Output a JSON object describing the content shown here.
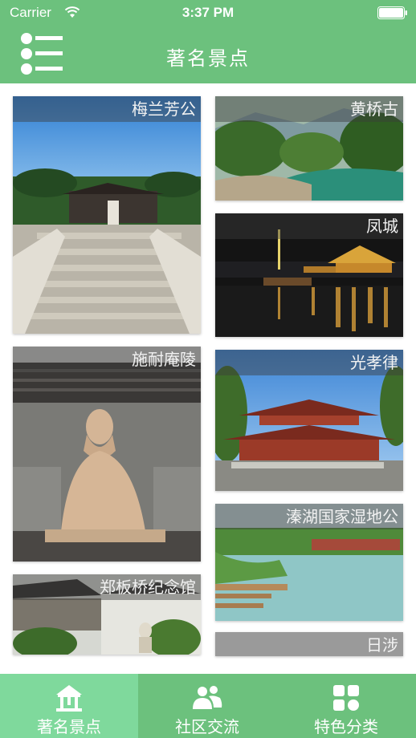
{
  "status_bar": {
    "carrier": "Carrier",
    "time": "3:37 PM"
  },
  "nav": {
    "title": "著名景点",
    "menu_icon": "list-menu-icon"
  },
  "spots": [
    {
      "name": "梅兰芳公"
    },
    {
      "name": "黄桥古"
    },
    {
      "name": "凤城"
    },
    {
      "name": "施耐庵陵"
    },
    {
      "name": "光孝律"
    },
    {
      "name": "溱湖国家湿地公"
    },
    {
      "name": "郑板桥纪念馆"
    },
    {
      "name": "日涉"
    }
  ],
  "tabs": [
    {
      "label": "著名景点",
      "icon": "pavilion-icon",
      "active": true
    },
    {
      "label": "社区交流",
      "icon": "community-icon",
      "active": false
    },
    {
      "label": "特色分类",
      "icon": "category-grid-icon",
      "active": false
    }
  ],
  "colors": {
    "brand_green": "#6cc17d",
    "active_tab": "#7fd99c"
  }
}
